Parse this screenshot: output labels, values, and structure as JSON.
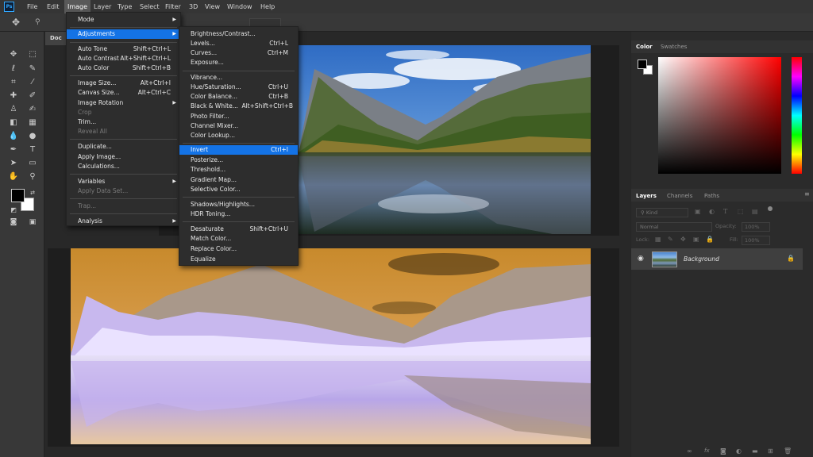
{
  "app": {
    "logo": "Ps"
  },
  "menubar": [
    "File",
    "Edit",
    "Image",
    "Layer",
    "Type",
    "Select",
    "Filter",
    "3D",
    "View",
    "Window",
    "Help"
  ],
  "doc_tab": "Doc",
  "image_menu": {
    "mode": "Mode",
    "adjustments": "Adjustments",
    "auto_tone": "Auto Tone",
    "auto_tone_sc": "Shift+Ctrl+L",
    "auto_contrast": "Auto Contrast",
    "auto_contrast_sc": "Alt+Shift+Ctrl+L",
    "auto_color": "Auto Color",
    "auto_color_sc": "Shift+Ctrl+B",
    "image_size": "Image Size...",
    "image_size_sc": "Alt+Ctrl+I",
    "canvas_size": "Canvas Size...",
    "canvas_size_sc": "Alt+Ctrl+C",
    "image_rotation": "Image Rotation",
    "crop": "Crop",
    "trim": "Trim...",
    "reveal_all": "Reveal All",
    "duplicate": "Duplicate...",
    "apply_image": "Apply Image...",
    "calculations": "Calculations...",
    "variables": "Variables",
    "apply_data_set": "Apply Data Set...",
    "trap": "Trap...",
    "analysis": "Analysis"
  },
  "adjustments_menu": {
    "brightness": "Brightness/Contrast...",
    "levels": "Levels...",
    "levels_sc": "Ctrl+L",
    "curves": "Curves...",
    "curves_sc": "Ctrl+M",
    "exposure": "Exposure...",
    "vibrance": "Vibrance...",
    "hue_sat": "Hue/Saturation...",
    "hue_sat_sc": "Ctrl+U",
    "color_balance": "Color Balance...",
    "color_balance_sc": "Ctrl+B",
    "bw": "Black & White...",
    "bw_sc": "Alt+Shift+Ctrl+B",
    "photo_filter": "Photo Filter...",
    "channel_mixer": "Channel Mixer...",
    "color_lookup": "Color Lookup...",
    "invert": "Invert",
    "invert_sc": "Ctrl+I",
    "posterize": "Posterize...",
    "threshold": "Threshold...",
    "gradient_map": "Gradient Map...",
    "selective_color": "Selective Color...",
    "shadows": "Shadows/Highlights...",
    "hdr": "HDR Toning...",
    "desaturate": "Desaturate",
    "desaturate_sc": "Shift+Ctrl+U",
    "match_color": "Match Color...",
    "replace_color": "Replace Color...",
    "equalize": "Equalize"
  },
  "color_panel": {
    "tab_color": "Color",
    "tab_swatches": "Swatches"
  },
  "layers_panel": {
    "tab_layers": "Layers",
    "tab_channels": "Channels",
    "tab_paths": "Paths",
    "kind": "Kind",
    "blend_mode": "Normal",
    "opacity_label": "Opacity:",
    "opacity_value": "100%",
    "lock_label": "Lock:",
    "fill_label": "Fill:",
    "fill_value": "100%",
    "layer_name": "Background"
  }
}
